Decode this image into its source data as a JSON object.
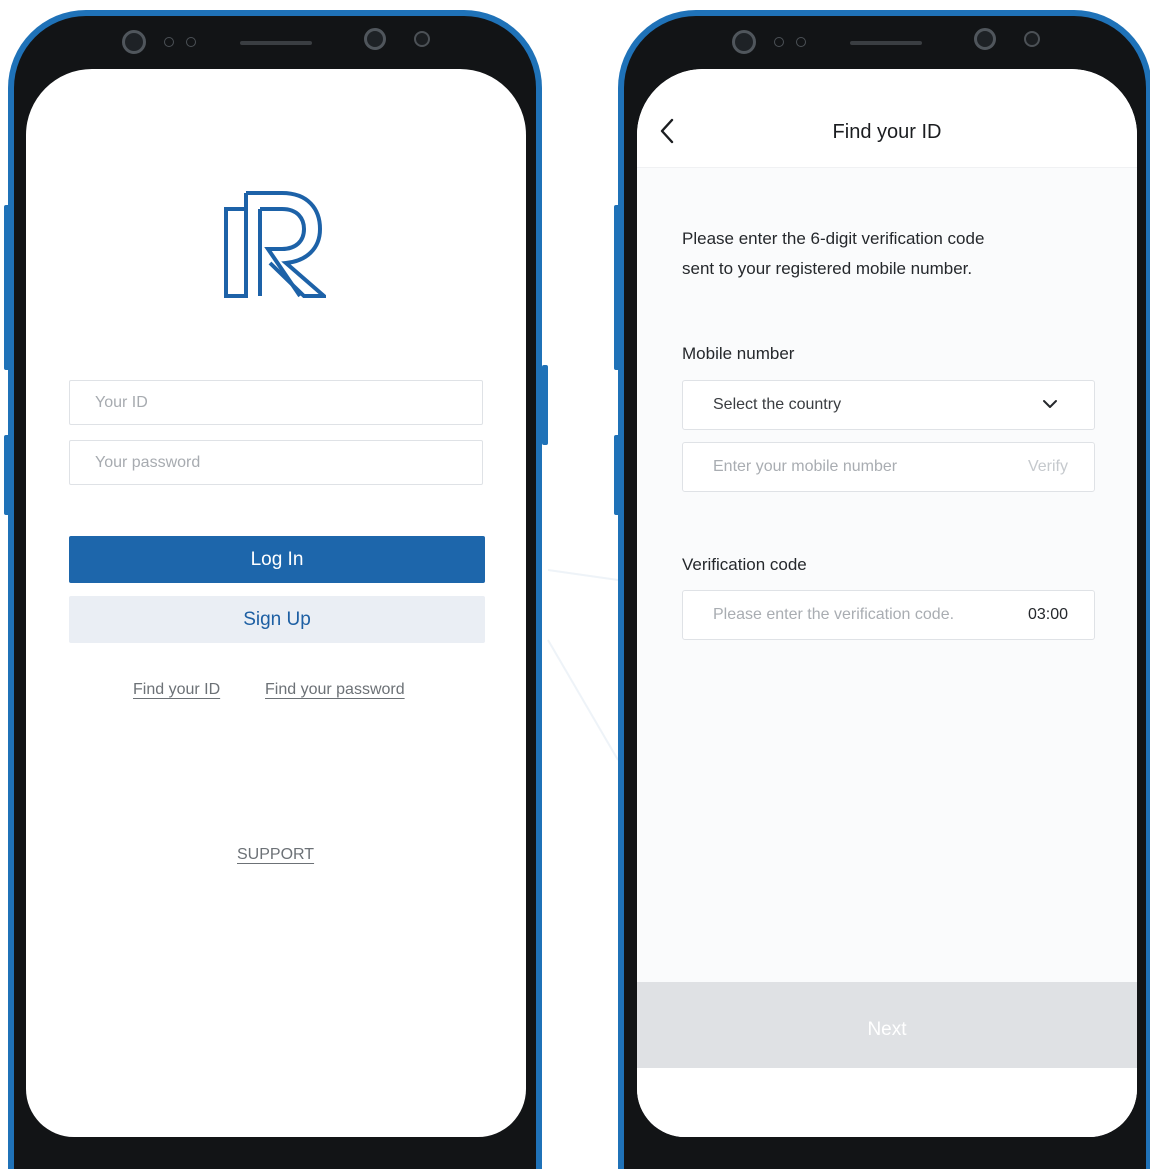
{
  "colors": {
    "frame_blue": "#1f72b8",
    "primary_button": "#1d66ab",
    "secondary_button": "#eaeef4",
    "disabled_button": "#dfe1e4"
  },
  "login_screen": {
    "logo_icon": "r-logo-icon",
    "id_placeholder": "Your ID",
    "password_placeholder": "Your password",
    "login_label": "Log In",
    "signup_label": "Sign Up",
    "find_id_link": "Find your ID",
    "find_password_link": "Find your password",
    "support_link": "SUPPORT"
  },
  "find_id_screen": {
    "back_icon": "back-arrow-icon",
    "title": "Find your ID",
    "instruction_line1": "Please enter the 6-digit verification code",
    "instruction_line2": "sent to your registered mobile number.",
    "mobile_label": "Mobile number",
    "country_select": "Select the country",
    "dropdown_icon": "chevron-down-icon",
    "mobile_placeholder": "Enter your mobile number",
    "verify_label": "Verify",
    "verification_label": "Verification code",
    "code_placeholder": "Please enter the verification code.",
    "timer": "03:00",
    "next_label": "Next"
  }
}
